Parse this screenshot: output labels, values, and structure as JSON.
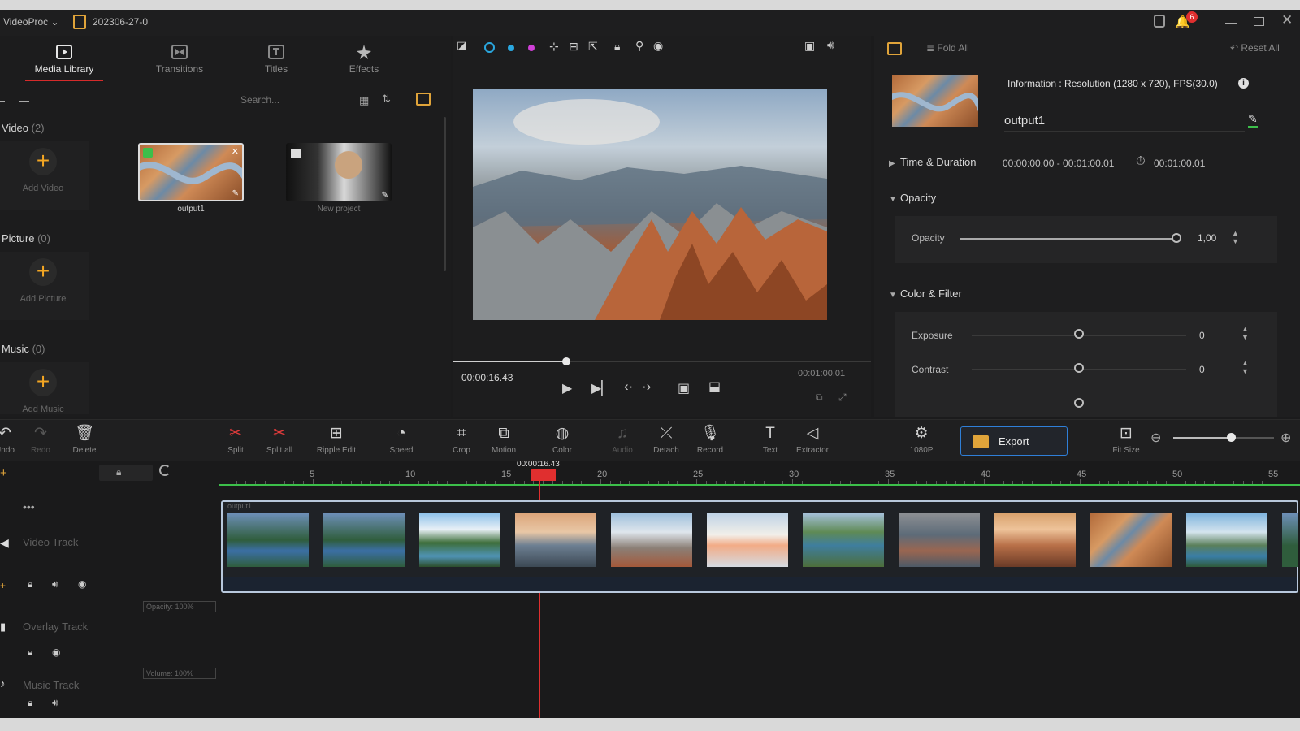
{
  "titlebar": {
    "app_name": "VideoProc",
    "project_name": "202306-27-0",
    "notification_count": "6"
  },
  "library": {
    "tabs": [
      {
        "label": "Media Library"
      },
      {
        "label": "Transitions"
      },
      {
        "label": "Titles"
      },
      {
        "label": "Effects"
      }
    ],
    "search_placeholder": "Search...",
    "video_section": {
      "title": "Video",
      "count": "(2)",
      "add_label": "Add Video"
    },
    "picture_section": {
      "title": "Picture",
      "count": "(0)",
      "add_label": "Add Picture"
    },
    "music_section": {
      "title": "Music",
      "count": "(0)",
      "add_label": "Add Music"
    },
    "videos": [
      {
        "name": "output1"
      },
      {
        "name": "New project"
      }
    ]
  },
  "preview": {
    "current_time": "00:00:16.43",
    "total_time": "00:01:00.01",
    "progress": 0.27
  },
  "properties": {
    "fold_all": "Fold All",
    "reset_all": "Reset All",
    "info": "Information : Resolution (1280 x 720), FPS(30.0)",
    "clip_name": "output1",
    "time_duration_label": "Time & Duration",
    "time_range": "00:00:00.00 - 00:01:00.01",
    "duration": "00:01:00.01",
    "opacity_section": "Opacity",
    "opacity_label": "Opacity",
    "opacity_value": "1,00",
    "color_filter_section": "Color & Filter",
    "exposure_label": "Exposure",
    "exposure_value": "0",
    "contrast_label": "Contrast",
    "contrast_value": "0"
  },
  "toolbar": {
    "undo": "Undo",
    "redo": "Redo",
    "delete": "Delete",
    "split": "Split",
    "split_all": "Split all",
    "ripple_edit": "Ripple Edit",
    "speed": "Speed",
    "crop": "Crop",
    "motion": "Motion",
    "color": "Color",
    "audio": "Audio",
    "detach": "Detach",
    "record": "Record",
    "text": "Text",
    "extractor": "Extractor",
    "quality": "1080P",
    "export": "Export",
    "fit_size": "Fit Size",
    "zoom_level": 0.57
  },
  "timeline": {
    "playhead_time": "00:00:16.43",
    "ruler_marks": [
      "5",
      "10",
      "15",
      "20",
      "25",
      "30",
      "35",
      "40",
      "45",
      "50",
      "55"
    ],
    "video_track_label": "Video Track",
    "overlay_track_label": "Overlay Track",
    "music_track_label": "Music Track",
    "overlay_opacity": "Opacity: 100%",
    "music_volume": "Volume: 100%",
    "clip_name": "output1"
  },
  "colors": {
    "accent_red": "#e02f2f",
    "accent_orange": "#f3a623",
    "export_border": "#2f7fd8"
  }
}
